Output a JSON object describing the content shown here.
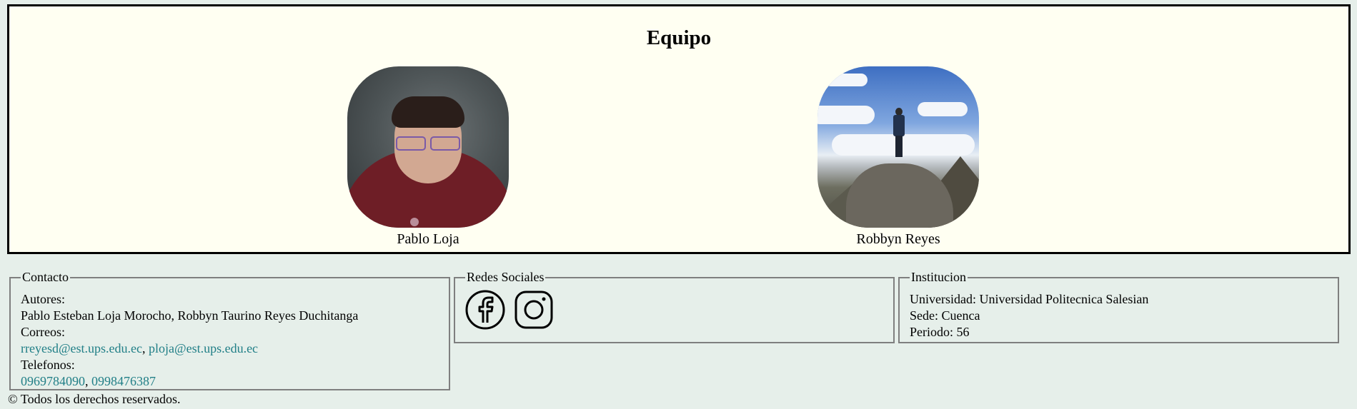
{
  "team": {
    "title": "Equipo",
    "members": [
      {
        "name": "Pablo Loja"
      },
      {
        "name": "Robbyn Reyes"
      }
    ]
  },
  "contact": {
    "legend": "Contacto",
    "authors_label": "Autores:",
    "authors": "Pablo Esteban Loja Morocho, Robbyn Taurino Reyes Duchitanga",
    "emails_label": "Correos:",
    "email1": "rreyesd@est.ups.edu.ec",
    "email2": "ploja@est.ups.edu.ec",
    "phones_label": "Telefonos:",
    "phone1": "0969784090",
    "phone2": "0998476387"
  },
  "social": {
    "legend": "Redes Sociales",
    "icons": [
      "facebook-icon",
      "instagram-icon"
    ]
  },
  "institution": {
    "legend": "Institucion",
    "university": "Universidad: Universidad Politecnica Salesian",
    "campus": "Sede: Cuenca",
    "period": "Periodo: 56"
  },
  "footer": {
    "copyright": "© Todos los derechos reservados."
  },
  "colors": {
    "background": "#e6efea",
    "panel": "#fffff2",
    "link": "#217f87"
  }
}
